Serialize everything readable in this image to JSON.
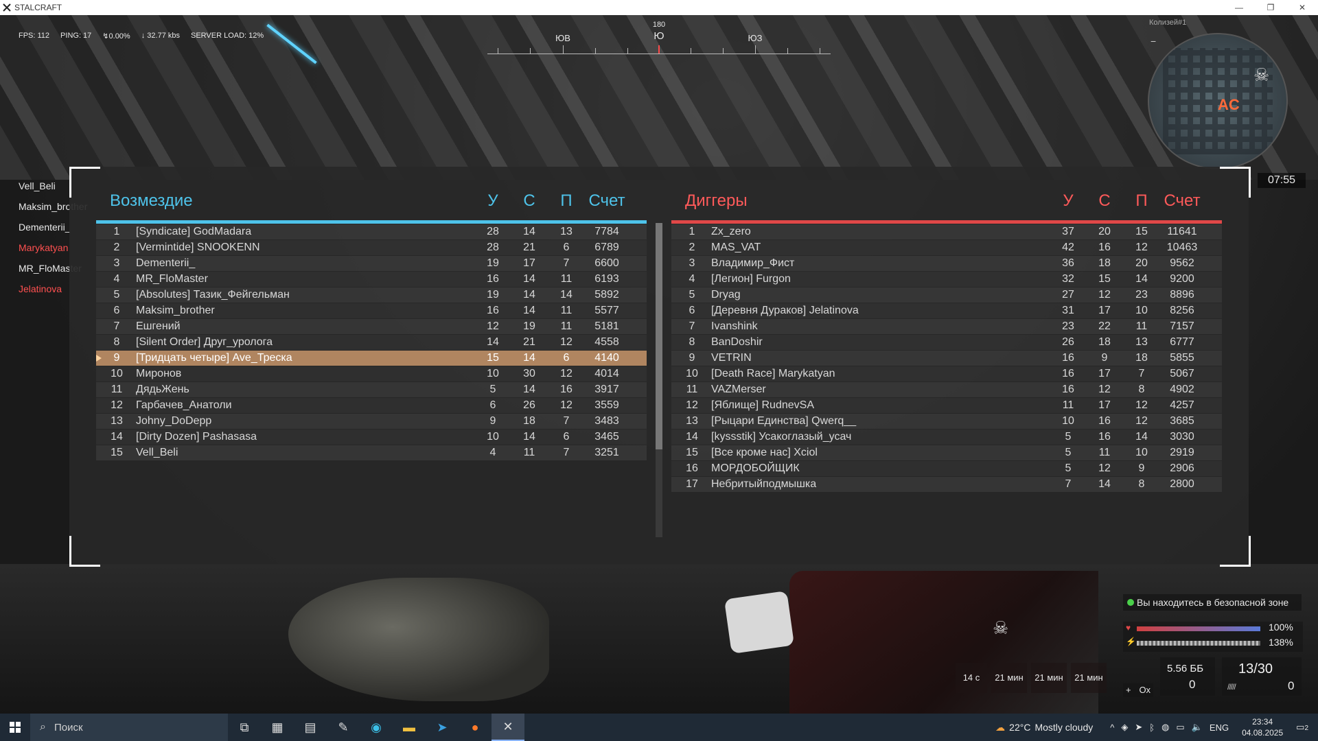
{
  "window": {
    "title": "STALCRAFT"
  },
  "hud": {
    "fps": "FPS: 112",
    "ping": "PING: 17",
    "loss": "0.00%",
    "download": "32.77 kbs",
    "server_load": "SERVER LOAD: 12%",
    "compass": {
      "deg": "180",
      "south": "Ю",
      "sw": "ЮЗ",
      "se": "ЮВ"
    },
    "map_title": "Колизей#1",
    "timer": "07:55",
    "safe_zone": "Вы находитесь в безопасной зоне",
    "health_pct": "100%",
    "stamina_pct": "138%",
    "slots": [
      "14 с",
      "21 мин",
      "21 мин",
      "21 мин"
    ],
    "ox": "Ох",
    "ammo_type": "5.56 ББ",
    "ammo_count": "0",
    "clip": "13/30",
    "reserve": "0"
  },
  "teammates": [
    {
      "name": "Vell_Beli",
      "team": "blue"
    },
    {
      "name": "Maksim_brother",
      "team": "blue"
    },
    {
      "name": "Dementerii_",
      "team": "blue"
    },
    {
      "name": "Marykatyan",
      "team": "red"
    },
    {
      "name": "MR_FloMaster",
      "team": "blue"
    },
    {
      "name": "Jelatinova",
      "team": "red"
    }
  ],
  "scoreboard": {
    "columns": {
      "kills": "У",
      "deaths": "С",
      "assists": "П",
      "score": "Счет"
    },
    "team_blue": {
      "name": "Возмездие",
      "rows": [
        [
          "1",
          "[Syndicate] GodMadara",
          "28",
          "14",
          "13",
          "7784"
        ],
        [
          "2",
          "[Vermintide] SNOOKENN",
          "28",
          "21",
          "6",
          "6789"
        ],
        [
          "3",
          "Dementerii_",
          "19",
          "17",
          "7",
          "6600"
        ],
        [
          "4",
          "MR_FloMaster",
          "16",
          "14",
          "11",
          "6193"
        ],
        [
          "5",
          "[Absolutes] Тазик_Фейгельман",
          "19",
          "14",
          "14",
          "5892"
        ],
        [
          "6",
          "Maksim_brother",
          "16",
          "14",
          "11",
          "5577"
        ],
        [
          "7",
          "Ешгений",
          "12",
          "19",
          "11",
          "5181"
        ],
        [
          "8",
          "[Silent Order] Друг_уролога",
          "14",
          "21",
          "12",
          "4558"
        ],
        [
          "9",
          "[Тридцать четыре] Ave_Треска",
          "15",
          "14",
          "6",
          "4140"
        ],
        [
          "10",
          "Миронов",
          "10",
          "30",
          "12",
          "4014"
        ],
        [
          "11",
          "ДядьЖень",
          "5",
          "14",
          "16",
          "3917"
        ],
        [
          "12",
          "Гарбачев_Анатоли",
          "6",
          "26",
          "12",
          "3559"
        ],
        [
          "13",
          "Johny_DoDepp",
          "9",
          "18",
          "7",
          "3483"
        ],
        [
          "14",
          "[Dirty Dozen] Pashasasa",
          "10",
          "14",
          "6",
          "3465"
        ],
        [
          "15",
          "Vell_Beli",
          "4",
          "11",
          "7",
          "3251"
        ]
      ],
      "highlight_index": 8
    },
    "team_red": {
      "name": "Диггеры",
      "rows": [
        [
          "1",
          "Zx_zero",
          "37",
          "20",
          "15",
          "11641"
        ],
        [
          "2",
          "MAS_VAT",
          "42",
          "16",
          "12",
          "10463"
        ],
        [
          "3",
          "Владимир_Фист",
          "36",
          "18",
          "20",
          "9562"
        ],
        [
          "4",
          "[Легион] Furgon",
          "32",
          "15",
          "14",
          "9200"
        ],
        [
          "5",
          "Dryag",
          "27",
          "12",
          "23",
          "8896"
        ],
        [
          "6",
          "[Деревня Дураков] Jelatinova",
          "31",
          "17",
          "10",
          "8256"
        ],
        [
          "7",
          "Ivanshink",
          "23",
          "22",
          "11",
          "7157"
        ],
        [
          "8",
          "BanDoshir",
          "26",
          "18",
          "13",
          "6777"
        ],
        [
          "9",
          "VETRIN",
          "16",
          "9",
          "18",
          "5855"
        ],
        [
          "10",
          "[Death Race] Marykatyan",
          "16",
          "17",
          "7",
          "5067"
        ],
        [
          "11",
          "VAZMerser",
          "16",
          "12",
          "8",
          "4902"
        ],
        [
          "12",
          "[Яблище] RudnevSA",
          "11",
          "17",
          "12",
          "4257"
        ],
        [
          "13",
          "[Рыцари Единства] Qwerq__",
          "10",
          "16",
          "12",
          "3685"
        ],
        [
          "14",
          "[kyssstik] Усакоглазый_усач",
          "5",
          "16",
          "14",
          "3030"
        ],
        [
          "15",
          "[Все кроме нас] Xciol",
          "5",
          "11",
          "10",
          "2919"
        ],
        [
          "16",
          "МОРДОБОЙЩИК",
          "5",
          "12",
          "9",
          "2906"
        ],
        [
          "17",
          "Небритыйподмышка",
          "7",
          "14",
          "8",
          "2800"
        ]
      ]
    }
  },
  "taskbar": {
    "search_placeholder": "Поиск",
    "temp": "22°C",
    "weather": "Mostly cloudy",
    "lang": "ENG",
    "time": "23:34",
    "date": "04.08.2025",
    "notifications": "2"
  },
  "colors": {
    "blue_team": "#4ec3ea",
    "red_team": "#ff5a5a",
    "highlight": "#b08560"
  }
}
